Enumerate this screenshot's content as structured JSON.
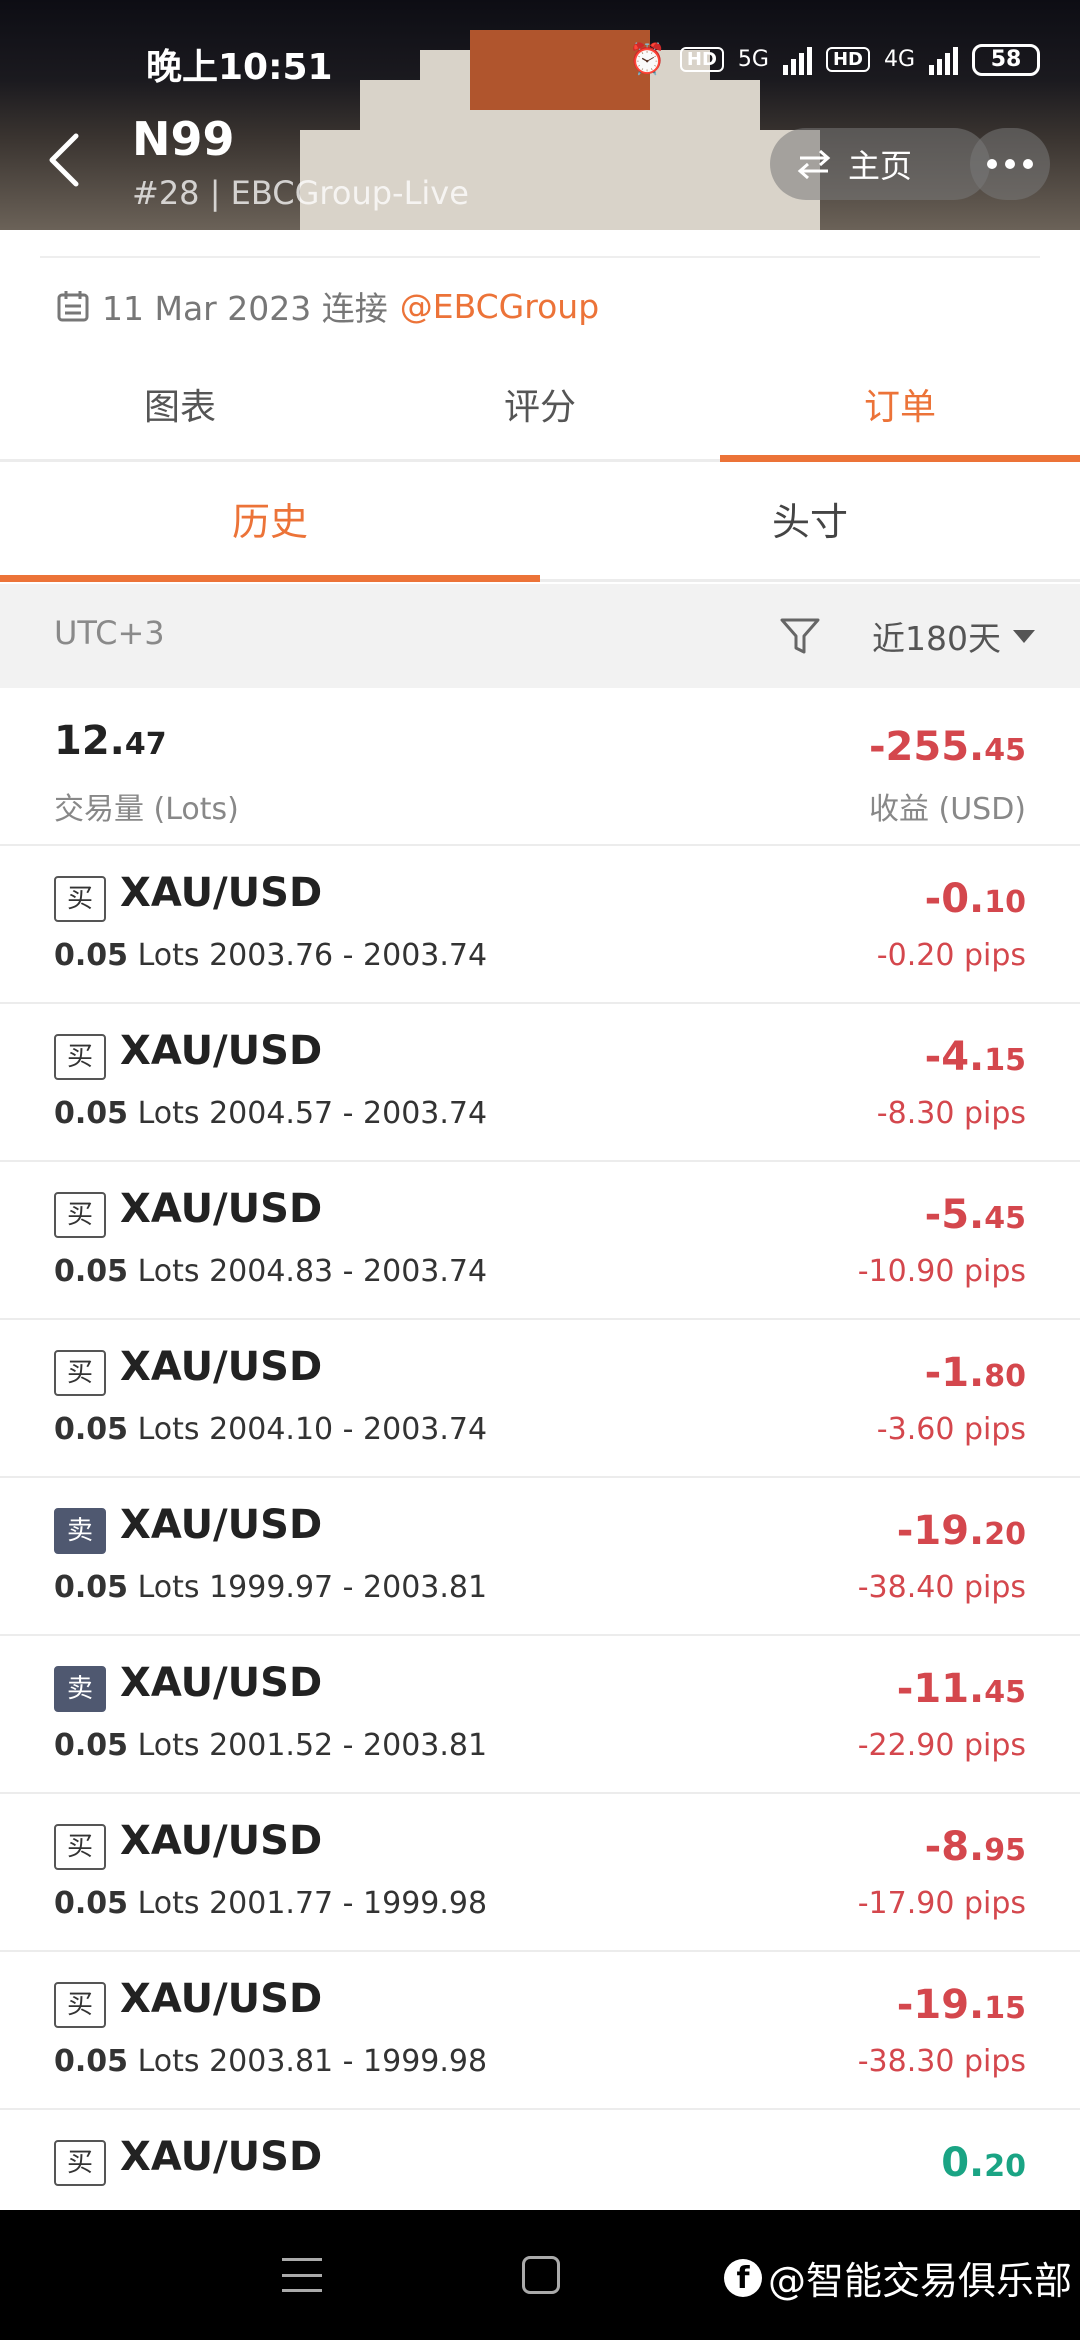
{
  "status_bar": {
    "time": "晚上10:51",
    "net1": "5G",
    "net2": "4G",
    "hd": "HD",
    "battery": "58"
  },
  "header": {
    "name": "N99",
    "subtitle": "#28 | EBCGroup-Live",
    "home_label": "主页"
  },
  "connected": {
    "date_text": "11 Mar 2023 连接",
    "broker": "@EBCGroup"
  },
  "tabs": [
    {
      "label": "图表",
      "active": false
    },
    {
      "label": "评分",
      "active": false
    },
    {
      "label": "订单",
      "active": true
    }
  ],
  "subtabs": [
    {
      "label": "历史",
      "active": true
    },
    {
      "label": "头寸",
      "active": false
    }
  ],
  "filter": {
    "timezone": "UTC+3",
    "range": "近180天"
  },
  "summary": {
    "volume_int": "12.",
    "volume_dec": "47",
    "volume_label": "交易量 (Lots)",
    "pl_int": "-255.",
    "pl_dec": "45",
    "pl_label": "收益 (USD)"
  },
  "orders": [
    {
      "side": "买",
      "sell": false,
      "symbol": "XAU/USD",
      "lots": "0.05",
      "lots_unit": "Lots",
      "prices": "2003.76 - 2003.74",
      "pl_int": "-0.",
      "pl_dec": "10",
      "pips": "-0.20 pips",
      "positive": false
    },
    {
      "side": "买",
      "sell": false,
      "symbol": "XAU/USD",
      "lots": "0.05",
      "lots_unit": "Lots",
      "prices": "2004.57 - 2003.74",
      "pl_int": "-4.",
      "pl_dec": "15",
      "pips": "-8.30 pips",
      "positive": false
    },
    {
      "side": "买",
      "sell": false,
      "symbol": "XAU/USD",
      "lots": "0.05",
      "lots_unit": "Lots",
      "prices": "2004.83 - 2003.74",
      "pl_int": "-5.",
      "pl_dec": "45",
      "pips": "-10.90 pips",
      "positive": false
    },
    {
      "side": "买",
      "sell": false,
      "symbol": "XAU/USD",
      "lots": "0.05",
      "lots_unit": "Lots",
      "prices": "2004.10 - 2003.74",
      "pl_int": "-1.",
      "pl_dec": "80",
      "pips": "-3.60 pips",
      "positive": false
    },
    {
      "side": "卖",
      "sell": true,
      "symbol": "XAU/USD",
      "lots": "0.05",
      "lots_unit": "Lots",
      "prices": "1999.97 - 2003.81",
      "pl_int": "-19.",
      "pl_dec": "20",
      "pips": "-38.40 pips",
      "positive": false
    },
    {
      "side": "卖",
      "sell": true,
      "symbol": "XAU/USD",
      "lots": "0.05",
      "lots_unit": "Lots",
      "prices": "2001.52 - 2003.81",
      "pl_int": "-11.",
      "pl_dec": "45",
      "pips": "-22.90 pips",
      "positive": false
    },
    {
      "side": "买",
      "sell": false,
      "symbol": "XAU/USD",
      "lots": "0.05",
      "lots_unit": "Lots",
      "prices": "2001.77 - 1999.98",
      "pl_int": "-8.",
      "pl_dec": "95",
      "pips": "-17.90 pips",
      "positive": false
    },
    {
      "side": "买",
      "sell": false,
      "symbol": "XAU/USD",
      "lots": "0.05",
      "lots_unit": "Lots",
      "prices": "2003.81 - 1999.98",
      "pl_int": "-19.",
      "pl_dec": "15",
      "pips": "-38.30 pips",
      "positive": false
    },
    {
      "side": "买",
      "sell": false,
      "symbol": "XAU/USD",
      "lots": "",
      "lots_unit": "",
      "prices": "",
      "pl_int": "0.",
      "pl_dec": "20",
      "pips": "",
      "positive": true
    }
  ],
  "watermark": {
    "text": "@智能交易俱乐部",
    "logo": "f"
  },
  "colors": {
    "accent": "#ec7338",
    "loss": "#d4474d",
    "profit": "#1aa484",
    "sell_badge": "#4f5870"
  }
}
